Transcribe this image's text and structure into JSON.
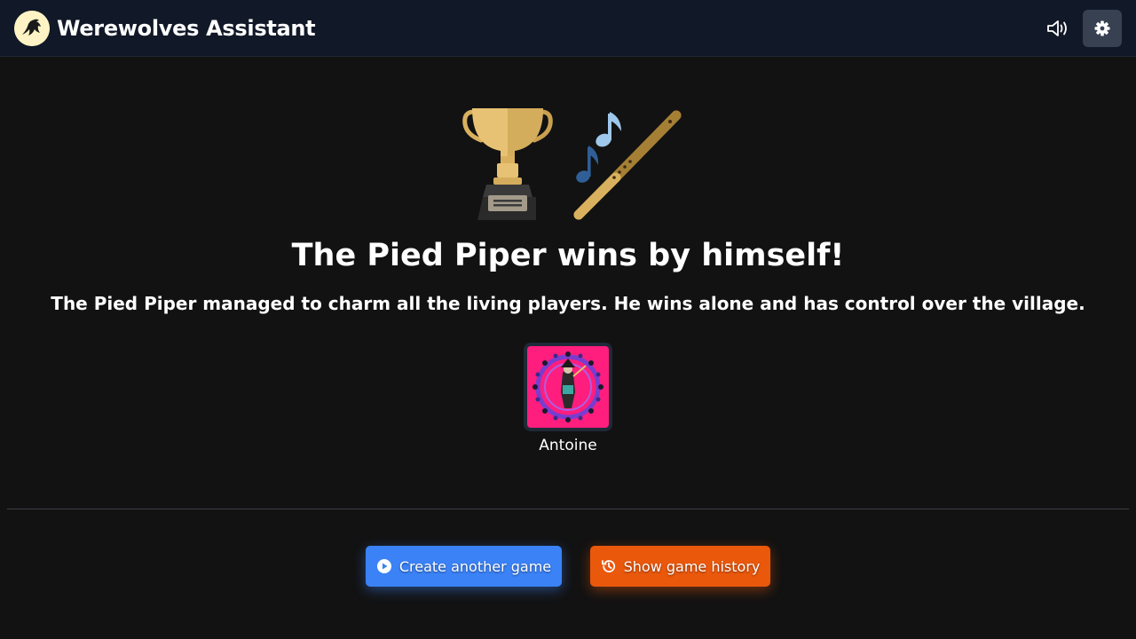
{
  "header": {
    "app_title": "Werewolves Assistant",
    "logo_icon": "werewolf-logo-icon",
    "sound_icon": "volume-icon",
    "settings_icon": "gear-icon"
  },
  "result": {
    "trophy_icon": "trophy-icon",
    "side_icon": "pied-piper-flute-icon",
    "title": "The Pied Piper wins by himself!",
    "description": "The Pied Piper managed to charm all the living players. He wins alone and has control over the village."
  },
  "winners": [
    {
      "name": "Antoine",
      "role_icon": "pied-piper-role-icon"
    }
  ],
  "actions": {
    "create_label": "Create another game",
    "create_icon": "play-circle-icon",
    "history_label": "Show game history",
    "history_icon": "history-icon"
  },
  "colors": {
    "background": "#121212",
    "topbar": "#111827",
    "create_button": "#3b82f6",
    "history_button": "#ea580c",
    "role_card_bg": "#ff1d7e"
  }
}
